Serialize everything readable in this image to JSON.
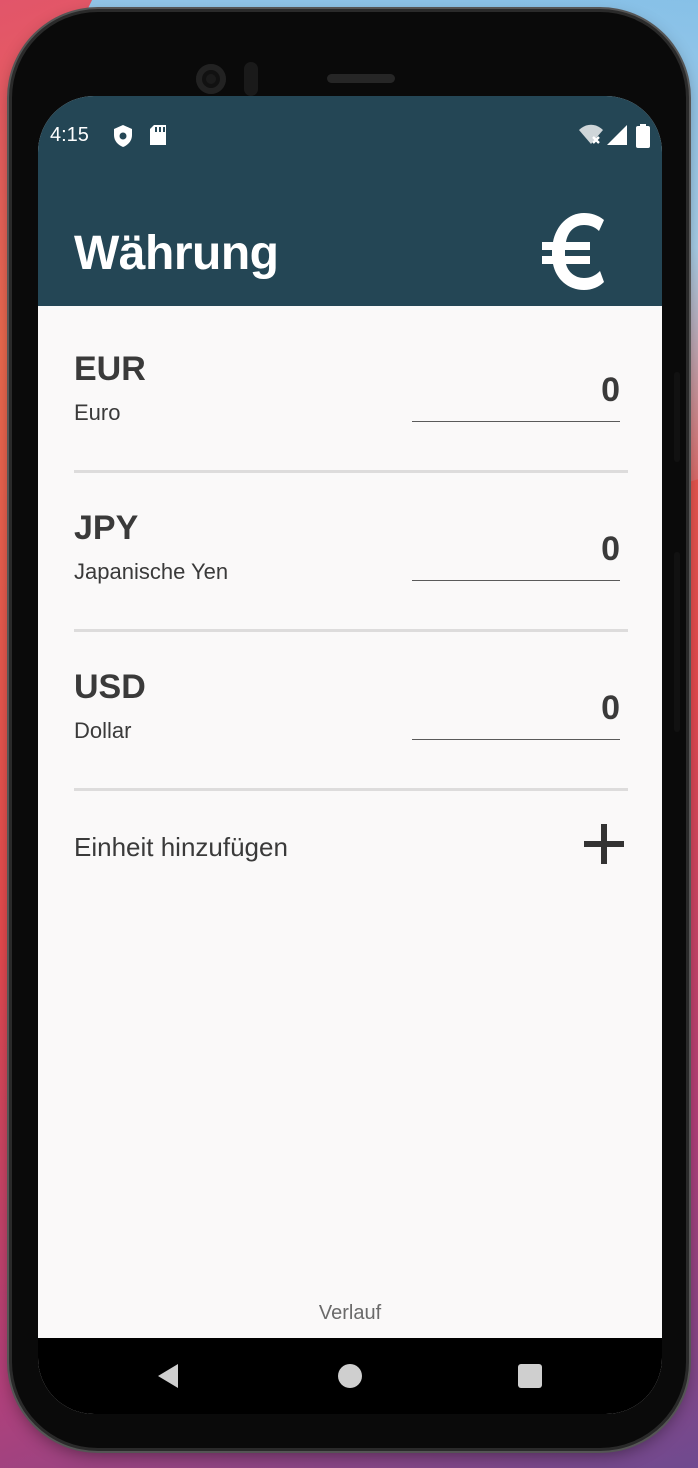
{
  "status_bar": {
    "time": "4:15",
    "icons": [
      "shield-icon",
      "sd-card-icon",
      "wifi-off-icon",
      "signal-icon",
      "battery-icon"
    ]
  },
  "app_bar": {
    "title": "Währung",
    "icon": "euro-icon",
    "background": "#244655"
  },
  "currencies": [
    {
      "code": "EUR",
      "name": "Euro",
      "value": "0"
    },
    {
      "code": "JPY",
      "name": "Japanische Yen",
      "value": "0"
    },
    {
      "code": "USD",
      "name": "Dollar",
      "value": "0"
    }
  ],
  "add_unit": {
    "label": "Einheit hinzufügen",
    "icon": "plus-icon"
  },
  "history": {
    "label": "Verlauf"
  },
  "nav": {
    "buttons": [
      "back-icon",
      "home-icon",
      "recents-icon"
    ]
  }
}
